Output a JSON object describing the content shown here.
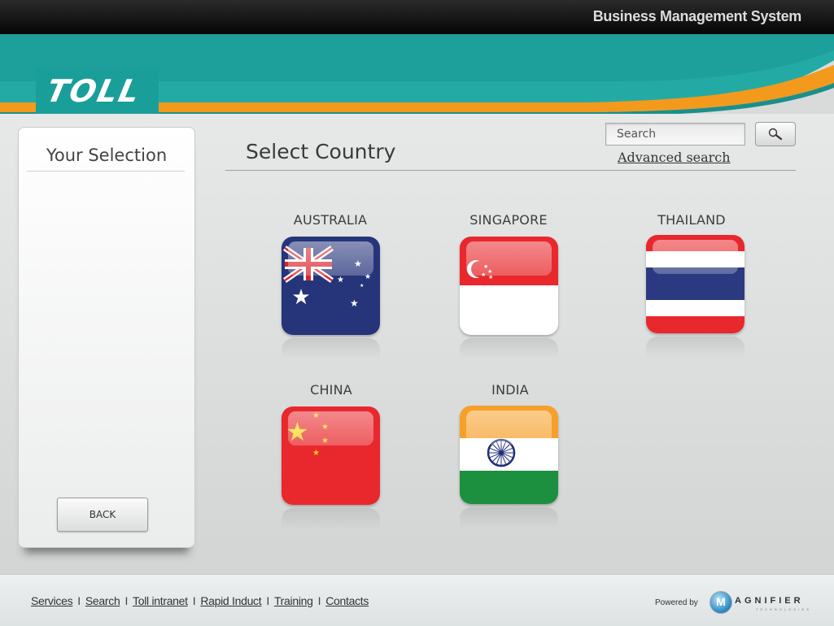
{
  "header": {
    "system_title": "Business Management System",
    "logo_text": "TOLL"
  },
  "sidebar": {
    "title": "Your Selection",
    "back_label": "BACK"
  },
  "main": {
    "heading": "Select Country",
    "search_placeholder": "Search",
    "advanced_search_label": "Advanced search",
    "countries": [
      {
        "name": "AUSTRALIA"
      },
      {
        "name": "SINGAPORE"
      },
      {
        "name": "THAILAND"
      },
      {
        "name": "CHINA"
      },
      {
        "name": "INDIA"
      }
    ]
  },
  "footer": {
    "links": [
      "Services",
      "Search",
      "Toll intranet",
      "Rapid Induct",
      "Training",
      "Contacts"
    ],
    "separator": "I",
    "powered_by": "Powered by",
    "vendor_mark": "M",
    "vendor_name": "AGNIFIER",
    "vendor_tagline": "TECHNOLOGIES"
  },
  "colors": {
    "brand_teal": "#1a9e9a",
    "accent_orange": "#f39a1c",
    "top_bar": "#0a0a0a"
  }
}
